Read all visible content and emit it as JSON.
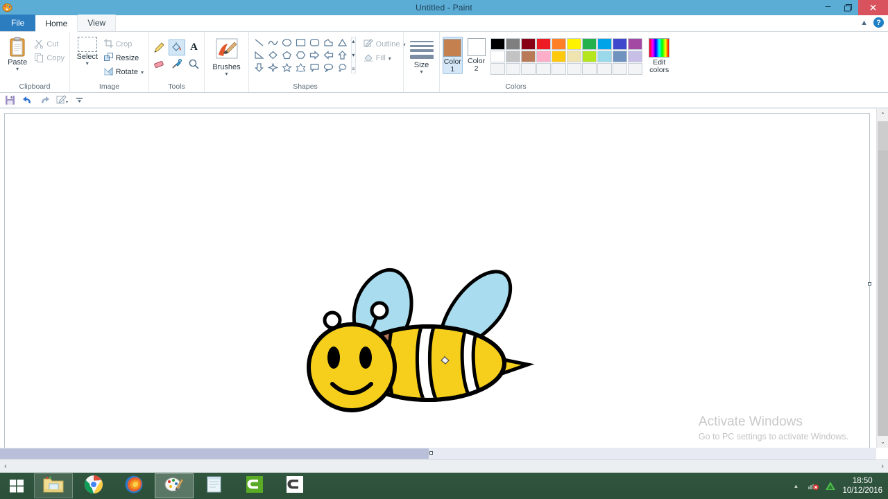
{
  "window": {
    "title": "Untitled - Paint",
    "app_icon": "paint-palette-icon",
    "minimize": "minimize-icon",
    "restore": "restore-icon",
    "close": "close-icon"
  },
  "tabs": [
    {
      "label": "File",
      "id": "file"
    },
    {
      "label": "Home",
      "id": "home"
    },
    {
      "label": "View",
      "id": "view"
    }
  ],
  "tabrow_right": {
    "collapse_ribbon": "chevron-up-icon",
    "help": "?"
  },
  "quick_access": [
    {
      "name": "save-icon",
      "glyph": "save"
    },
    {
      "name": "undo-icon",
      "glyph": "undo"
    },
    {
      "name": "redo-icon",
      "glyph": "redo"
    },
    {
      "name": "edit-with-paint3d-icon",
      "glyph": "edit"
    },
    {
      "name": "customize-qat-icon",
      "glyph": "caret"
    }
  ],
  "ribbon": {
    "groups": [
      {
        "id": "clipboard",
        "label": "Clipboard",
        "big": {
          "label": "Paste",
          "caret": "▾",
          "icon": "paste-icon"
        },
        "items": [
          {
            "label": "Cut",
            "icon": "scissors-icon",
            "dim": true
          },
          {
            "label": "Copy",
            "icon": "copy-icon",
            "dim": true
          }
        ]
      },
      {
        "id": "image",
        "label": "Image",
        "big": {
          "label": "Select",
          "caret": "▾",
          "icon": "select-icon"
        },
        "items": [
          {
            "label": "Crop",
            "icon": "crop-icon",
            "dim": true
          },
          {
            "label": "Resize",
            "icon": "resize-icon",
            "dim": false
          },
          {
            "label": "Rotate",
            "icon": "rotate-icon",
            "dim": false,
            "caret": "▾"
          }
        ]
      },
      {
        "id": "tools",
        "label": "Tools",
        "tools": [
          {
            "name": "pencil-tool",
            "selected": false
          },
          {
            "name": "fill-with-color-tool",
            "selected": true
          },
          {
            "name": "text-tool",
            "selected": false
          },
          {
            "name": "eraser-tool",
            "selected": false
          },
          {
            "name": "color-picker-tool",
            "selected": false
          },
          {
            "name": "magnifier-tool",
            "selected": false
          }
        ]
      },
      {
        "id": "brushes",
        "label": "",
        "big": {
          "label": "Brushes",
          "caret": "▾",
          "icon": "brushes-icon"
        }
      },
      {
        "id": "shapes",
        "label": "Shapes",
        "shapes": [
          "line",
          "curve",
          "oval",
          "rectangle",
          "rounded-rectangle",
          "polygon",
          "triangle",
          "right-triangle",
          "diamond",
          "pentagon",
          "hexagon",
          "right-arrow",
          "left-arrow",
          "up-arrow",
          "down-arrow",
          "four-point-star",
          "five-point-star",
          "six-point-star",
          "rounded-rectangle-callout",
          "oval-callout",
          "cloud-callout"
        ],
        "scroll": {
          "up": "▴",
          "down": "▾",
          "expand": "≡"
        },
        "outline": {
          "label": "Outline",
          "caret": "▾",
          "icon": "outline-icon"
        },
        "fill": {
          "label": "Fill",
          "caret": "▾",
          "icon": "fill-icon"
        }
      },
      {
        "id": "size",
        "label": "",
        "big": {
          "label": "Size",
          "caret": "▾",
          "icon": "size-icon"
        }
      },
      {
        "id": "colors",
        "label": "Colors",
        "color1": {
          "label_line1": "Color",
          "label_line2": "1",
          "value": "#c4814f",
          "active": true
        },
        "color2": {
          "label_line1": "Color",
          "label_line2": "2",
          "value": "#ffffff",
          "active": false
        },
        "palette_row1": [
          "#000000",
          "#7f7f7f",
          "#880015",
          "#ed1c24",
          "#ff7f27",
          "#fff200",
          "#22b14c",
          "#00a2e8",
          "#3f48cc",
          "#a349a4"
        ],
        "palette_row2": [
          "#ffffff",
          "#c3c3c3",
          "#b97a57",
          "#ffaec9",
          "#ffc90e",
          "#efe4b0",
          "#b5e61d",
          "#99d9ea",
          "#7092be",
          "#c8bfe7"
        ],
        "palette_row3": [
          "#f2f4f6",
          "#f2f4f6",
          "#f2f4f6",
          "#f2f4f6",
          "#f2f4f6",
          "#f2f4f6",
          "#f2f4f6",
          "#f2f4f6",
          "#f2f4f6",
          "#f2f4f6"
        ],
        "edit_colors": {
          "label_line1": "Edit",
          "label_line2": "colors",
          "icon": "rainbow-icon"
        }
      }
    ]
  },
  "canvas": {
    "drawing_name": "cartoon-bee-drawing",
    "cursor": "paint-bucket-cursor",
    "colors": {
      "body_yellow": "#f6cf1c",
      "wing_blue": "#a8dcee",
      "stripe_brown": "#b5795a",
      "stripe_white": "#ffffff",
      "outline_black": "#000000"
    },
    "watermark": {
      "line1": "Activate Windows",
      "line2": "Go to PC settings to activate Windows."
    },
    "vscroll": {
      "up": "⌃",
      "down": "⌄"
    },
    "hscroll": {
      "left": "‹",
      "right": "›"
    }
  },
  "taskbar": {
    "start": "windows-start-icon",
    "items": [
      {
        "name": "file-explorer",
        "icon": "folder-icon",
        "state": "hover"
      },
      {
        "name": "google-chrome",
        "icon": "chrome-icon",
        "state": "normal"
      },
      {
        "name": "mozilla-firefox",
        "icon": "firefox-icon",
        "state": "normal"
      },
      {
        "name": "paint",
        "icon": "paint-palette-icon",
        "state": "active"
      },
      {
        "name": "notepad",
        "icon": "notepad-icon",
        "state": "normal"
      },
      {
        "name": "camtasia-recorder",
        "icon": "camtasia-green-icon",
        "state": "normal"
      },
      {
        "name": "camtasia-studio",
        "icon": "camtasia-white-icon",
        "state": "normal"
      }
    ],
    "tray": {
      "show_hidden": "▴",
      "icons": [
        "network-disconnected-icon",
        "green-triangle-icon"
      ],
      "time": "18:50",
      "date": "10/12/2016"
    }
  }
}
